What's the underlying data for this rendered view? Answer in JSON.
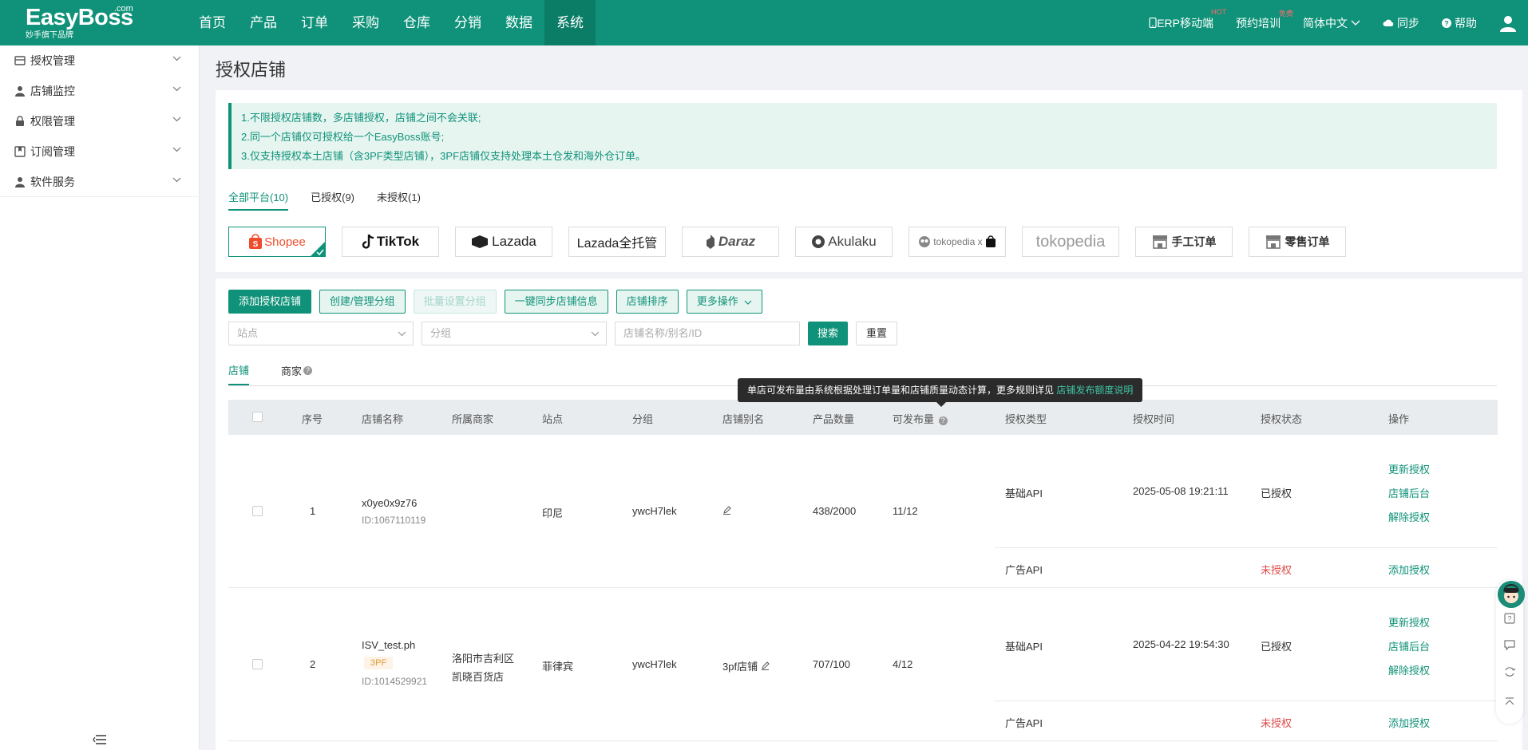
{
  "brand": {
    "name": "EasyBoss",
    "com": ".com",
    "sub": "妙手旗下品牌"
  },
  "nav": [
    "首页",
    "产品",
    "订单",
    "采购",
    "仓库",
    "分销",
    "数据",
    "系统"
  ],
  "nav_active": "系统",
  "top_right": {
    "erp": "ERP移动端",
    "erp_badge": "HOT",
    "training": "预约培训",
    "training_badge": "免费",
    "lang": "简体中文",
    "sync": "同步",
    "help": "帮助"
  },
  "sidebar": [
    {
      "label": "授权管理",
      "icon": "store-icon"
    },
    {
      "label": "店铺监控",
      "icon": "person-icon"
    },
    {
      "label": "权限管理",
      "icon": "lock-icon"
    },
    {
      "label": "订阅管理",
      "icon": "bookmark-icon"
    },
    {
      "label": "软件服务",
      "icon": "person-icon"
    }
  ],
  "page_title": "授权店铺",
  "notice": [
    "1.不限授权店铺数，多店铺授权，店铺之间不会关联;",
    "2.同一个店铺仅可授权给一个EasyBoss账号;",
    "3.仅支持授权本土店铺（含3PF类型店铺），3PF店铺仅支持处理本土仓发和海外仓订单。"
  ],
  "platform_tabs": [
    "全部平台(10)",
    "已授权(9)",
    "未授权(1)"
  ],
  "platforms": [
    "Shopee",
    "TikTok",
    "Lazada",
    "Lazada全托管",
    "Daraz",
    "Akulaku",
    "tokopedia x",
    "tokopedia",
    "手工订单",
    "零售订单"
  ],
  "toolbar": {
    "add": "添加授权店铺",
    "group": "创建/管理分组",
    "batch": "批量设置分组",
    "sync": "一键同步店铺信息",
    "sort": "店铺排序",
    "more": "更多操作"
  },
  "filters": {
    "site_placeholder": "站点",
    "group_placeholder": "分组",
    "search_placeholder": "店铺名称/别名/ID",
    "search": "搜索",
    "reset": "重置"
  },
  "sub_tabs": [
    "店铺",
    "商家"
  ],
  "tooltip": {
    "text": "单店可发布量由系统根据处理订单量和店铺质量动态计算，更多规则详见",
    "link": "店铺发布额度说明"
  },
  "columns": [
    "序号",
    "店铺名称",
    "所属商家",
    "站点",
    "分组",
    "店铺别名",
    "产品数量",
    "可发布量",
    "授权类型",
    "授权时间",
    "授权状态",
    "操作"
  ],
  "rows": [
    {
      "no": "1",
      "name": "x0ye0x9z76",
      "tag": "",
      "id": "ID:1067110119",
      "merchant_line1": "",
      "merchant_line2": "",
      "site": "印尼",
      "group": "ywcH7lek",
      "alias": "",
      "products": "438/2000",
      "publishable": "11/12",
      "auth": [
        {
          "type": "基础API",
          "time": "2025-05-08 19:21:11",
          "status": "已授权",
          "ops": [
            "更新授权",
            "店铺后台",
            "解除授权"
          ]
        },
        {
          "type": "广告API",
          "time": "",
          "status": "未授权",
          "ops": [
            "添加授权"
          ]
        }
      ]
    },
    {
      "no": "2",
      "name": "ISV_test.ph",
      "tag": "3PF",
      "id": "ID:1014529921",
      "merchant_line1": "洛阳市吉利区",
      "merchant_line2": "凯晓百货店",
      "site": "菲律宾",
      "group": "ywcH7lek",
      "alias": "3pf店铺",
      "products": "707/100",
      "publishable": "4/12",
      "auth": [
        {
          "type": "基础API",
          "time": "2025-04-22 19:54:30",
          "status": "已授权",
          "ops": [
            "更新授权",
            "店铺后台",
            "解除授权"
          ]
        },
        {
          "type": "广告API",
          "time": "",
          "status": "未授权",
          "ops": [
            "添加授权"
          ]
        }
      ]
    }
  ],
  "colors": {
    "primary": "#0f9279",
    "danger": "#e04b4b",
    "notice_bg": "#e7f5f1"
  }
}
